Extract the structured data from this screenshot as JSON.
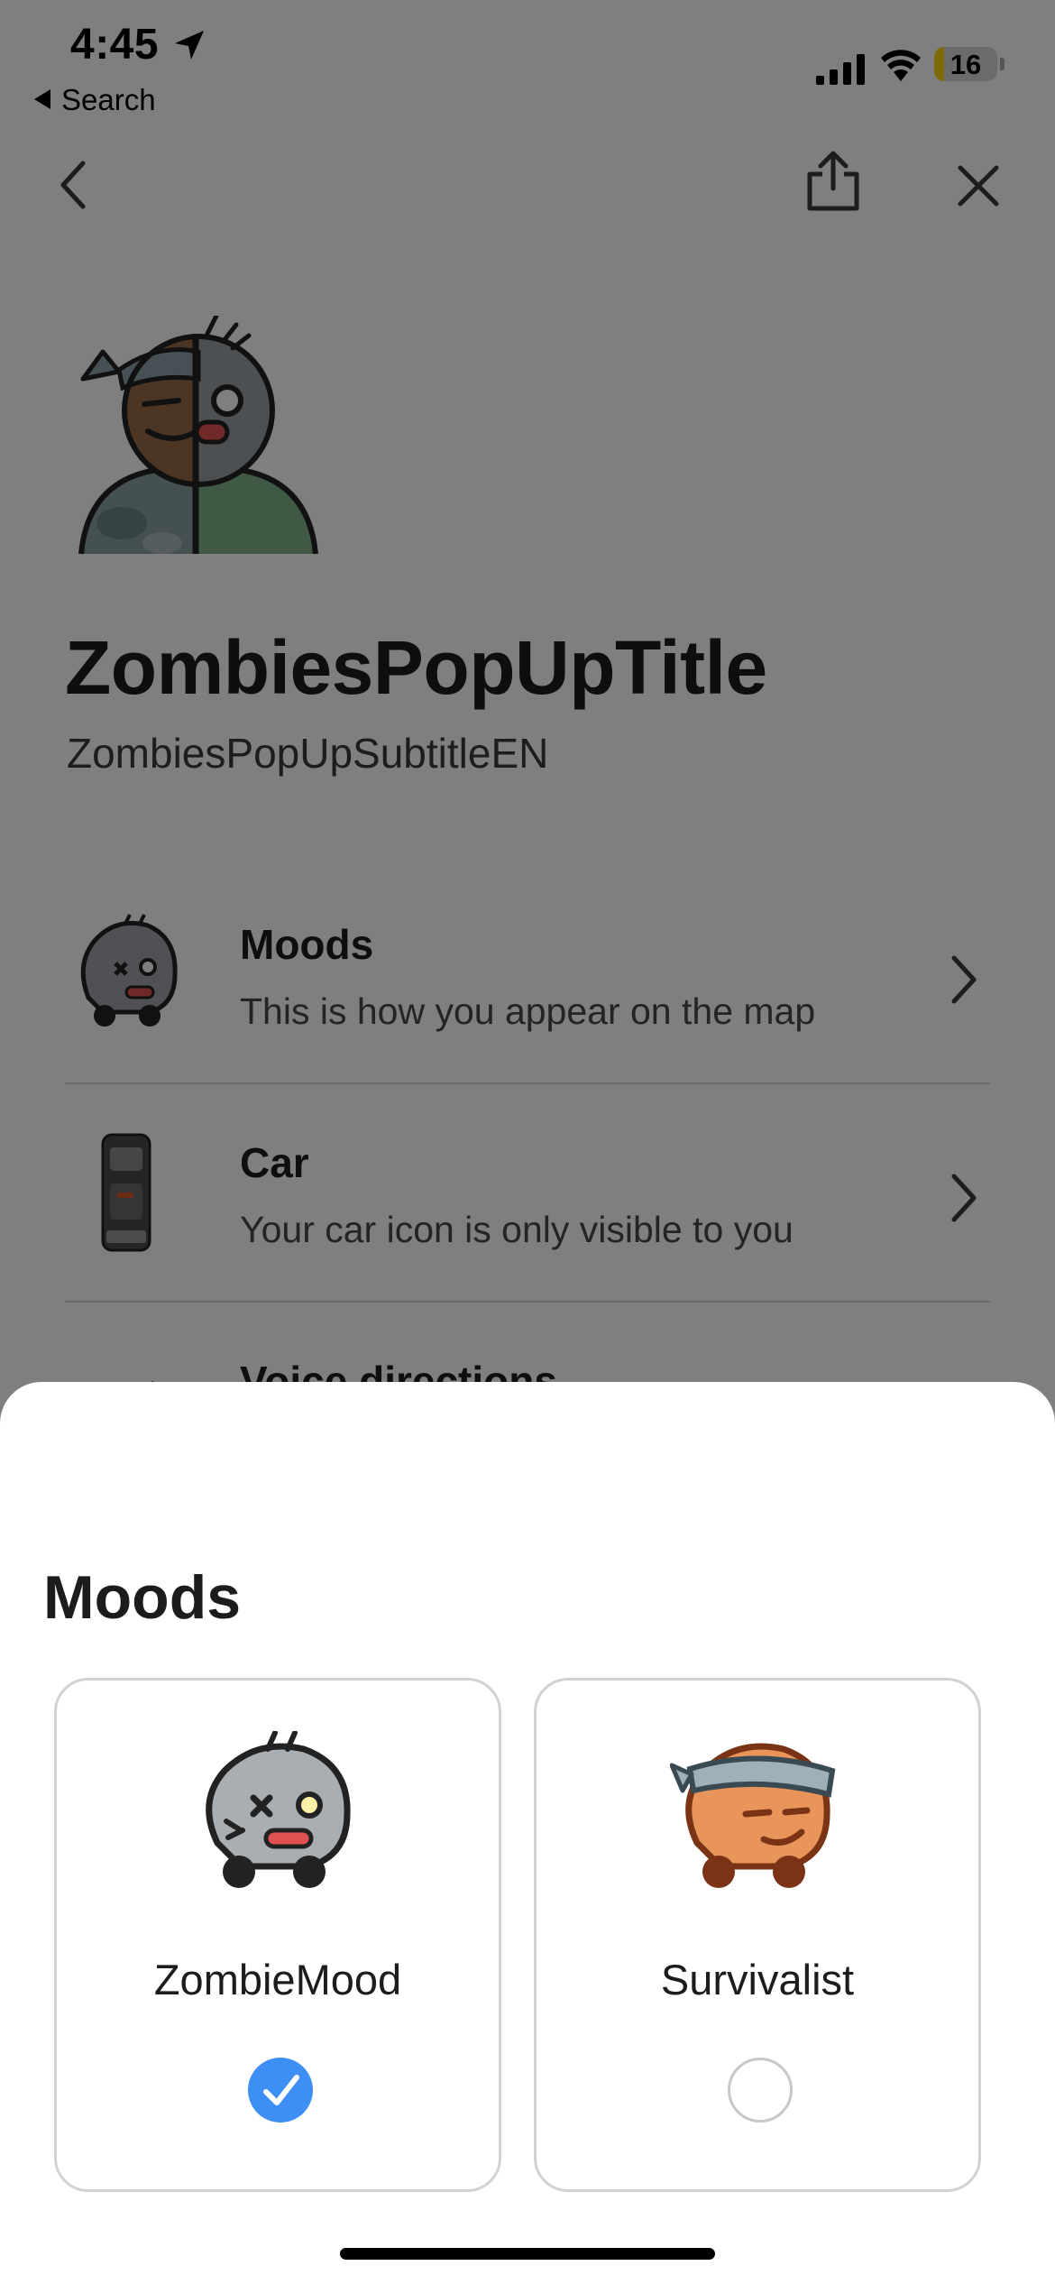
{
  "status_bar": {
    "time": "4:45",
    "back_app_label": "Search",
    "battery_level": "16"
  },
  "nav": {
    "back_icon": "chevron-left-icon",
    "share_icon": "share-icon",
    "close_icon": "close-icon"
  },
  "header": {
    "title": "ZombiesPopUpTitle",
    "subtitle": "ZombiesPopUpSubtitleEN"
  },
  "settings_list": [
    {
      "title": "Moods",
      "description": "This is how you appear on the map"
    },
    {
      "title": "Car",
      "description": "Your car icon is only visible to you"
    },
    {
      "title": "Voice directions",
      "description": ""
    }
  ],
  "moods_sheet": {
    "title": "Moods",
    "options": [
      {
        "label": "ZombieMood",
        "selected": true
      },
      {
        "label": "Survivalist",
        "selected": false
      }
    ]
  },
  "colors": {
    "accent": "#3d8ef5",
    "scrim": "#000000",
    "battery_low": "#ffd60a"
  }
}
